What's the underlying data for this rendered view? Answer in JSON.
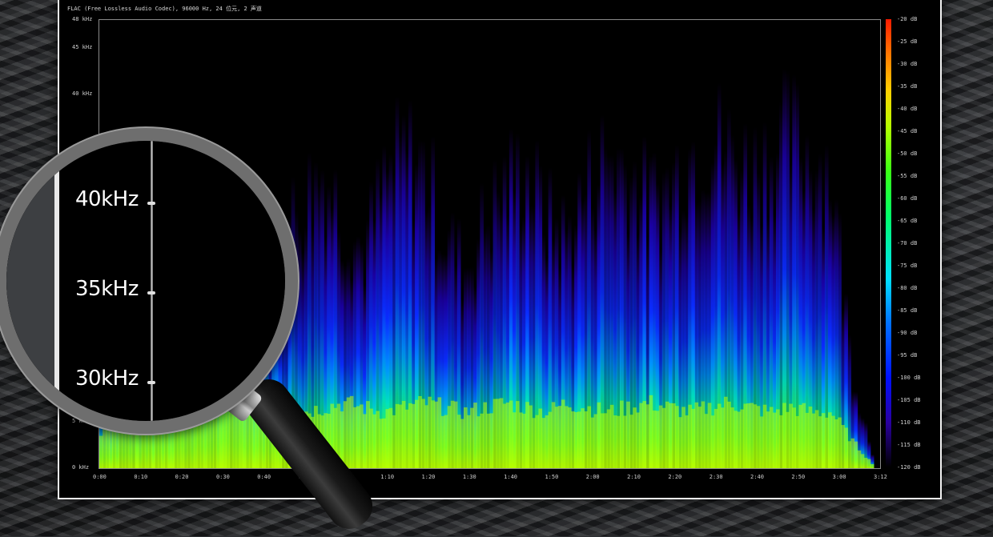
{
  "header": {
    "file_info": "FLAC (Free Lossless Audio Codec), 96000 Hz, 24 位元, 2 声道"
  },
  "chart_data": {
    "type": "heatmap",
    "title": "",
    "xlabel": "",
    "ylabel": "",
    "x_ticks": [
      "0:00",
      "0:10",
      "0:20",
      "0:30",
      "0:40",
      "0:50",
      "1:00",
      "1:10",
      "1:20",
      "1:30",
      "1:40",
      "1:50",
      "2:00",
      "2:10",
      "2:20",
      "2:30",
      "2:40",
      "2:50",
      "3:00",
      "3:12"
    ],
    "y_ticks": [
      "48 kHz",
      "45 kHz",
      "40 kHz",
      "5 kHz",
      "0 kHz"
    ],
    "colorbar_ticks": [
      "-20 dB",
      "-25 dB",
      "-30 dB",
      "-35 dB",
      "-40 dB",
      "-45 dB",
      "-50 dB",
      "-55 dB",
      "-60 dB",
      "-65 dB",
      "-70 dB",
      "-75 dB",
      "-80 dB",
      "-85 dB",
      "-90 dB",
      "-95 dB",
      "-100 dB",
      "-105 dB",
      "-110 dB",
      "-115 dB",
      "-120 dB"
    ],
    "x_range_seconds": [
      0,
      192
    ],
    "y_range_khz": [
      0,
      48
    ],
    "colorbar_range_db": [
      -20,
      -120
    ],
    "energy_profile": {
      "time_s": [
        0,
        5,
        10,
        15,
        20,
        25,
        30,
        35,
        40,
        45,
        50,
        55,
        60,
        65,
        70,
        75,
        80,
        85,
        90,
        95,
        100,
        105,
        110,
        115,
        120,
        125,
        130,
        135,
        140,
        145,
        150,
        155,
        160,
        165,
        170,
        175,
        180,
        185,
        190
      ],
      "upper_freq_khz": [
        14,
        16,
        18,
        22,
        24,
        26,
        28,
        30,
        26,
        28,
        32,
        36,
        30,
        26,
        34,
        38,
        36,
        28,
        24,
        30,
        34,
        36,
        30,
        28,
        34,
        38,
        36,
        32,
        34,
        38,
        40,
        38,
        36,
        38,
        40,
        38,
        36,
        12,
        2
      ],
      "green_band_khz": [
        4,
        4.5,
        5,
        5.5,
        6,
        5.5,
        6,
        6.5,
        6,
        5.5,
        6,
        6.5,
        7,
        6.5,
        6,
        6.5,
        7,
        6.5,
        6,
        6.5,
        7,
        6.5,
        6,
        7,
        6.5,
        6,
        6.5,
        7,
        6.5,
        6,
        6.5,
        7,
        6.5,
        6,
        6.5,
        6,
        6,
        3,
        0.5
      ]
    },
    "colors": {
      "background": "#000000",
      "low": "#1a00a0",
      "mid": "#0a2cff",
      "high": "#00e0c0",
      "peak": "#b8ff00"
    }
  },
  "magnifier": {
    "labels": [
      "40kHz",
      "35kHz",
      "30kHz"
    ]
  }
}
